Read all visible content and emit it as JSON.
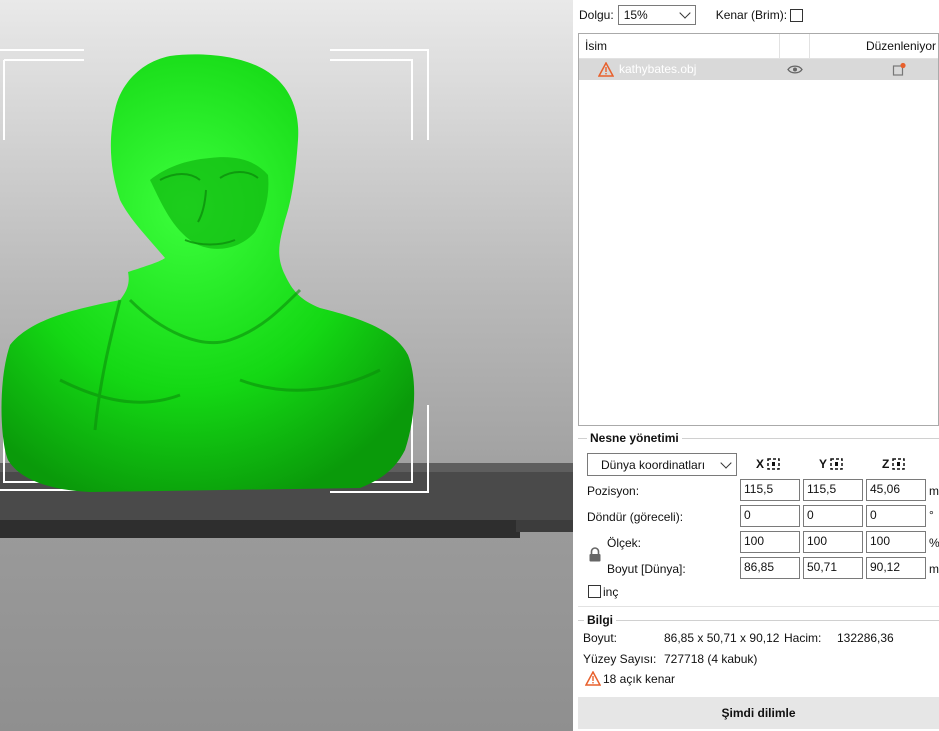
{
  "infill": {
    "label": "Dolgu:",
    "value": "15%"
  },
  "brim": {
    "label": "Kenar (Brim):",
    "checked": false
  },
  "object_list": {
    "columns": [
      "İsim",
      "Düzenleniyor"
    ],
    "rows": [
      {
        "name": "kathybates.obj",
        "warning": true,
        "visible_icon": "eye-icon",
        "edit_icon": "edit-object-icon"
      }
    ]
  },
  "object_manipulation": {
    "title": "Nesne yönetimi",
    "coord_system": "Dünya koordinatları",
    "axes": [
      "X",
      "Y",
      "Z"
    ],
    "rows": [
      {
        "label": "Pozisyon:",
        "x": "115,5",
        "y": "115,5",
        "z": "45,06",
        "unit": "m"
      },
      {
        "label": "Döndür (göreceli):",
        "x": "0",
        "y": "0",
        "z": "0",
        "unit": "°"
      },
      {
        "label": "Ölçek:",
        "x": "100",
        "y": "100",
        "z": "100",
        "unit": "%"
      },
      {
        "label": "Boyut [Dünya]:",
        "x": "86,85",
        "y": "50,71",
        "z": "90,12",
        "unit": "m"
      }
    ],
    "inch_label": "inç"
  },
  "info": {
    "title": "Bilgi",
    "size_label": "Boyut:",
    "size_value": "86,85 x 50,71 x 90,12",
    "volume_label": "Hacim:",
    "volume_value": "132286,36",
    "facets_label": "Yüzey Sayısı:",
    "facets_value": "727718 (4 kabuk)",
    "warning_text": "18 açık kenar"
  },
  "slice_button": "Şimdi dilimle",
  "colors": {
    "model": "#16e016",
    "warning": "#e8602c",
    "bed": "#3a3a3a"
  }
}
